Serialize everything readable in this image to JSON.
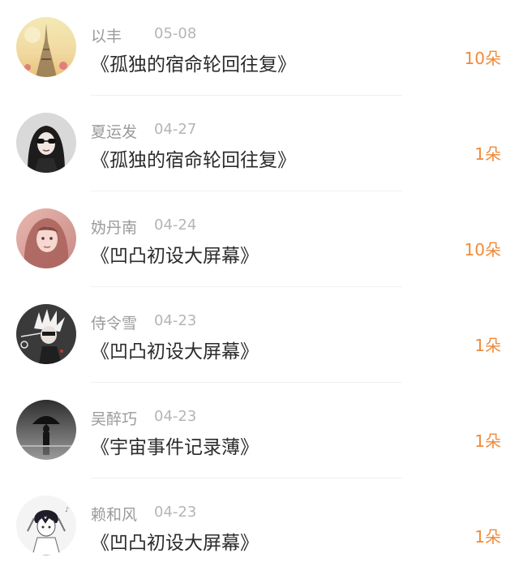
{
  "records": [
    {
      "name": "以丰",
      "date": "05-08",
      "title": "《孤独的宿命轮回往复》",
      "count": "10朵"
    },
    {
      "name": "夏运发",
      "date": "04-27",
      "title": "《孤独的宿命轮回往复》",
      "count": "1朵"
    },
    {
      "name": "妫丹南",
      "date": "04-24",
      "title": "《凹凸初设大屏幕》",
      "count": "10朵"
    },
    {
      "name": "侍令雪",
      "date": "04-23",
      "title": "《凹凸初设大屏幕》",
      "count": "1朵"
    },
    {
      "name": "吴醉巧",
      "date": "04-23",
      "title": "《宇宙事件记录薄》",
      "count": "1朵"
    },
    {
      "name": "赖和风",
      "date": "04-23",
      "title": "《凹凸初设大屏幕》",
      "count": "1朵"
    }
  ],
  "colors": {
    "accent": "#ef8a3a",
    "name_text": "#9b9b9b",
    "date_text": "#b5b5b5",
    "title_text": "#2b2b2b"
  }
}
